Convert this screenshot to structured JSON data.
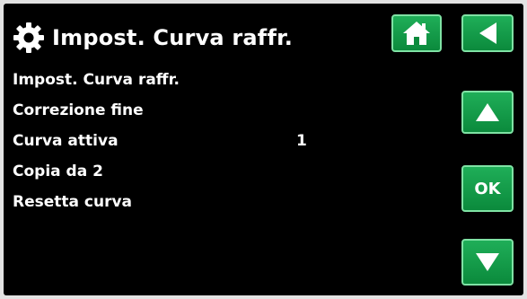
{
  "header": {
    "title": "Impost. Curva raffr.",
    "settings_icon": "gear-icon"
  },
  "menu": {
    "items": [
      {
        "label": "Impost. Curva raffr.",
        "value": ""
      },
      {
        "label": "Correzione fine",
        "value": ""
      },
      {
        "label": "Curva attiva",
        "value": "1"
      },
      {
        "label": "Copia da 2",
        "value": ""
      },
      {
        "label": "Resetta curva",
        "value": ""
      }
    ]
  },
  "buttons": {
    "home_icon": "home-icon",
    "back_icon": "back-arrow-icon",
    "up_icon": "up-arrow-icon",
    "ok_label": "OK",
    "down_icon": "down-arrow-icon"
  },
  "colors": {
    "background": "#000000",
    "text": "#ffffff",
    "button_green": "#14a04a",
    "button_border": "#7fe2a4"
  }
}
